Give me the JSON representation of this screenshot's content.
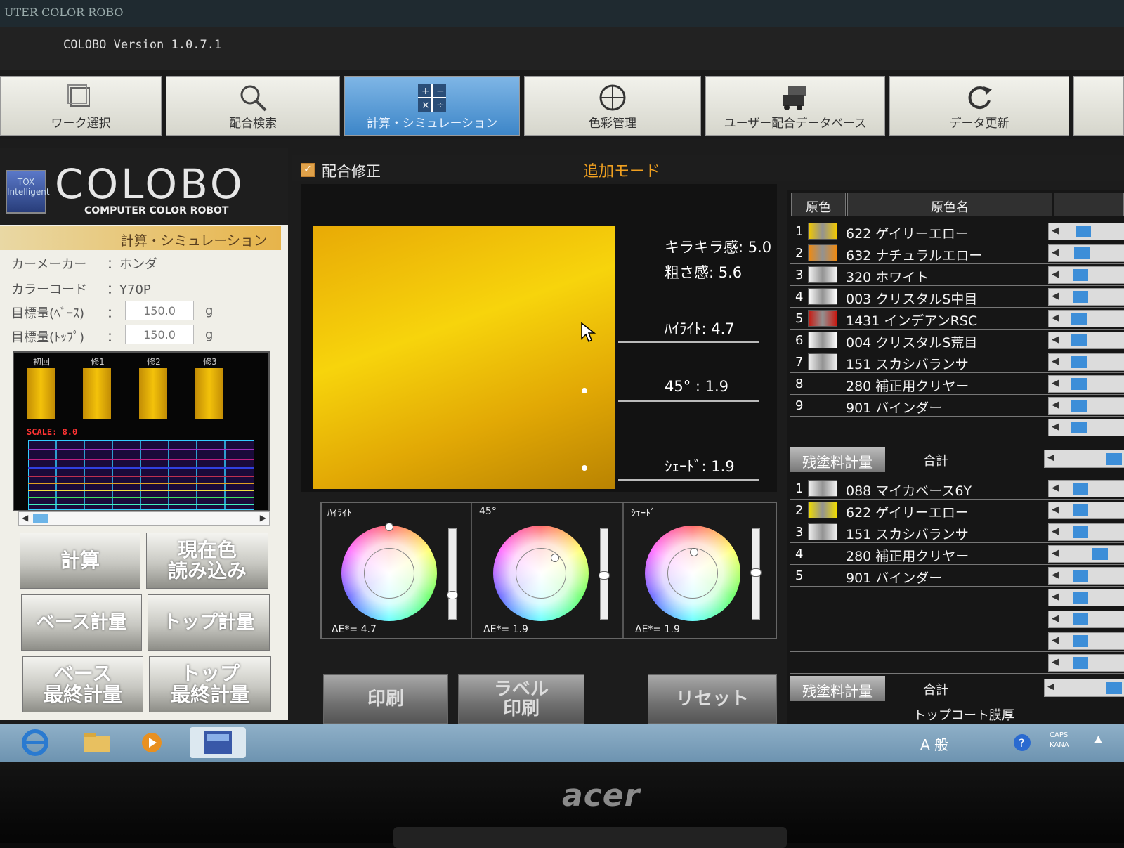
{
  "window": {
    "title": "UTER COLOR ROBO",
    "version": "COLOBO Version 1.0.7.1"
  },
  "toolbar": [
    {
      "label": "ワーク選択",
      "icon": "folder-stack-icon",
      "active": false
    },
    {
      "label": "配合検索",
      "icon": "magnifier-icon",
      "active": false
    },
    {
      "label": "計算・シミュレーション",
      "icon": "calculator-icon",
      "active": true
    },
    {
      "label": "色彩管理",
      "icon": "crosshair-icon",
      "active": false
    },
    {
      "label": "ユーザー配合データベース",
      "icon": "cars-icon",
      "active": false
    },
    {
      "label": "データ更新",
      "icon": "refresh-icon",
      "active": false
    }
  ],
  "logo": {
    "badge": "TOX Intelligent",
    "name": "COLOBO",
    "subtitle": "COMPUTER COLOR ROBOT"
  },
  "left": {
    "mode_title": "計算・シミュレーション",
    "maker_label": "カーメーカー",
    "maker_value": "：ホンダ",
    "color_code_label": "カラーコード",
    "color_code_value": "：Y70P",
    "target_base_label": "目標量(ﾍﾞｰｽ)",
    "target_base_sep": "：",
    "target_base_value": "150.0",
    "target_top_label": "目標量(ﾄｯﾌﾟ)",
    "target_top_sep": "：",
    "target_top_value": "150.0",
    "unit": "g",
    "trials": [
      "初回",
      "修1",
      "修2",
      "修3"
    ],
    "scale_label": "SCALE: 8.0",
    "buttons": {
      "calc": "計算",
      "read_current_1": "現在色",
      "read_current_2": "読み込み",
      "base_weigh": "ベース計量",
      "top_weigh": "トップ計量",
      "base_final_1": "ベース",
      "base_final_2": "最終計量",
      "top_final_1": "トップ",
      "top_final_2": "最終計量"
    }
  },
  "center": {
    "checkbox_label": "配合修正",
    "checkbox_checked": true,
    "mode": "追加モード",
    "sparkle": "キラキラ感: 5.0",
    "coarseness": "粗さ感: 5.6",
    "highlight": "ﾊｲﾗｲﾄ:  4.7",
    "angle45": "45°  :  1.9",
    "shade": "ｼｪｰﾄﾞ:  1.9",
    "wheels": [
      {
        "title": "ﾊｲﾗｲﾄ",
        "delta": "ΔE*= 4.7"
      },
      {
        "title": "45°",
        "delta": "ΔE*= 1.9"
      },
      {
        "title": "ｼｪｰﾄﾞ",
        "delta": "ΔE*= 1.9"
      }
    ],
    "buttons": {
      "print": "印刷",
      "label_print_1": "ラベル",
      "label_print_2": "印刷",
      "reset": "リセット"
    }
  },
  "right": {
    "header_color": "原色",
    "header_name": "原色名",
    "pigments": [
      {
        "num": "1",
        "name": "622 ゲイリーエロー",
        "color": "#f2c800",
        "level": 0.25
      },
      {
        "num": "2",
        "name": "632 ナチュラルエロー",
        "color": "#f08a10",
        "level": 0.22
      },
      {
        "num": "3",
        "name": "320 ホワイト",
        "color": "#f4f4f4",
        "level": 0.2
      },
      {
        "num": "4",
        "name": "003 クリスタルS中目",
        "color": "#ffffff",
        "level": 0.2
      },
      {
        "num": "5",
        "name": "1431 インデアンRSC",
        "color": "#c81810",
        "level": 0.18
      },
      {
        "num": "6",
        "name": "004 クリスタルS荒目",
        "color": "#ffffff",
        "level": 0.18
      },
      {
        "num": "7",
        "name": "151 スカシバランサ",
        "color": "#f0f0f0",
        "level": 0.18
      },
      {
        "num": "8",
        "name": "280 補正用クリヤー",
        "color": "",
        "level": 0.18
      },
      {
        "num": "9",
        "name": "901 バインダー",
        "color": "",
        "level": 0.18
      },
      {
        "num": "",
        "name": "",
        "color": "",
        "level": 0.18
      }
    ],
    "remaining_label": "残塗料計量",
    "total_label": "合計",
    "top_pigments": [
      {
        "num": "1",
        "name": "088 マイカベース6Y",
        "color": "#f2f2f2",
        "level": 0.2
      },
      {
        "num": "2",
        "name": "622 ゲイリーエロー",
        "color": "#f0dc00",
        "level": 0.2
      },
      {
        "num": "3",
        "name": "151 スカシバランサ",
        "color": "#f0f0f0",
        "level": 0.2
      },
      {
        "num": "4",
        "name": "280 補正用クリヤー",
        "color": "",
        "level": 0.55
      },
      {
        "num": "5",
        "name": "901 バインダー",
        "color": "",
        "level": 0.2
      },
      {
        "num": "",
        "name": "",
        "color": "",
        "level": 0.2
      },
      {
        "num": "",
        "name": "",
        "color": "",
        "level": 0.2
      },
      {
        "num": "",
        "name": "",
        "color": "",
        "level": 0.2
      },
      {
        "num": "",
        "name": "",
        "color": "",
        "level": 0.2
      }
    ],
    "remaining_label_2": "残塗料計量",
    "total_label_2": "合計",
    "topcoat_label": "トップコート膜厚"
  },
  "taskbar": {
    "tray_text": "A 般",
    "caps": "CAPS",
    "kana": "KANA"
  },
  "monitor_brand": "acer",
  "colors": {
    "accent_blue": "#3d86c8",
    "accent_orange": "#f0a020",
    "swatch_yellow": "#f3c20a"
  }
}
